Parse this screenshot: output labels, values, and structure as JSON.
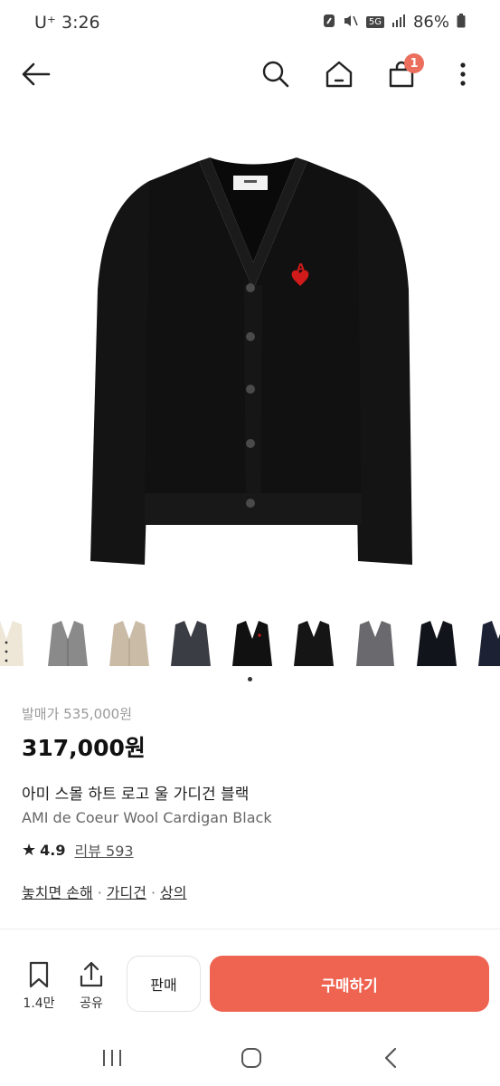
{
  "status_bar": {
    "carrier_time": "U⁺ 3:26",
    "battery": "86%"
  },
  "top_nav": {
    "back_icon": "arrow-left-icon",
    "search_icon": "search-icon",
    "home_icon": "home-icon",
    "bag_icon": "shopping-bag-icon",
    "bag_badge": "1",
    "more_icon": "more-vertical-icon",
    "badge_color": "#ec6e5c"
  },
  "thumbnails": [
    {
      "name": "cream"
    },
    {
      "name": "grey"
    },
    {
      "name": "beige"
    },
    {
      "name": "charcoal"
    },
    {
      "name": "black"
    },
    {
      "name": "black-2"
    },
    {
      "name": "dark-grey"
    },
    {
      "name": "navy-black"
    },
    {
      "name": "navy"
    }
  ],
  "product": {
    "original_price": "발매가 535,000원",
    "price": "317,000원",
    "name_ko": "아미 스몰 하트 로고 울 가디건 블랙",
    "name_en": "AMI de Coeur Wool Cardigan Black",
    "rating": "4.9",
    "reviews": "리뷰 593",
    "tags": [
      "놓치면 손해",
      "가디건",
      "상의"
    ]
  },
  "bottom_bar": {
    "bookmark_count": "1.4만",
    "share_label": "공유",
    "sell_label": "판매",
    "buy_label": "구매하기",
    "buy_color": "#ef6351"
  }
}
